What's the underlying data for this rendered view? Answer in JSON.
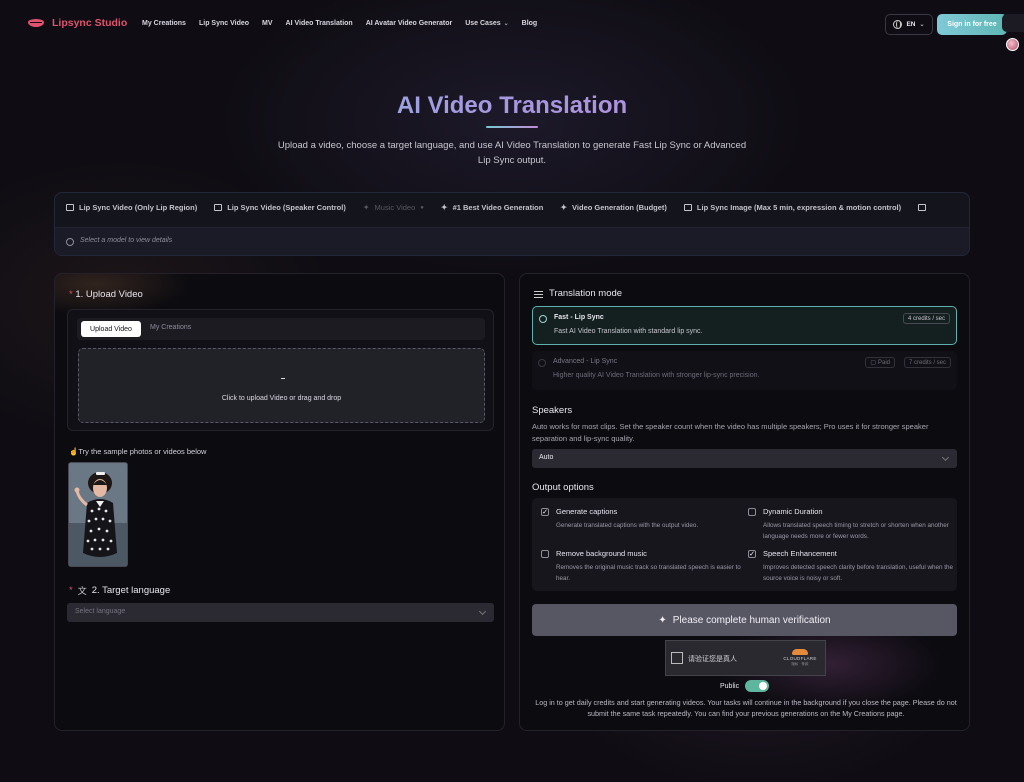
{
  "nav": {
    "brand": "Lipsync Studio",
    "links": [
      "My Creations",
      "Lip Sync Video",
      "MV",
      "AI Video Translation",
      "AI Avatar Video Generator",
      "Use Cases",
      "Blog"
    ],
    "language": "EN",
    "signin_label": "Sign in for free"
  },
  "hero": {
    "title": "AI Video Translation",
    "subtitle": "Upload a video, choose a target language, and use AI Video Translation to generate Fast Lip Sync or Advanced Lip Sync output."
  },
  "models": {
    "tabs": [
      {
        "label": "Lip Sync Video (Only Lip Region)",
        "icon": "video-icon",
        "disabled": false
      },
      {
        "label": "Lip Sync Video (Speaker Control)",
        "icon": "video-icon",
        "disabled": false
      },
      {
        "label": "Music Video",
        "icon": "music-icon",
        "disabled": true
      },
      {
        "label": "#1 Best Video Generation",
        "icon": "sparkle-icon",
        "disabled": false
      },
      {
        "label": "Video Generation (Budget)",
        "icon": "sparkle-icon",
        "disabled": false
      },
      {
        "label": "Lip Sync Image (Max 5 min, expression & motion control)",
        "icon": "image-icon",
        "disabled": false
      }
    ],
    "hint": "Select a model to view details"
  },
  "upload": {
    "section_label": "1. Upload Video",
    "tab_active": "Upload Video",
    "tab_other": "My Creations",
    "dropzone_dash": "-",
    "dropzone_text": "Click to upload Video or drag and drop",
    "sample_label": "Try the sample photos or videos below"
  },
  "target": {
    "section_label": "2. Target language",
    "placeholder": "Select language"
  },
  "translation": {
    "title": "Translation mode",
    "options": [
      {
        "name": "Fast - Lip Sync",
        "desc": "Fast AI Video Translation with standard lip sync.",
        "credits": "4 credits / sec",
        "badge": ""
      },
      {
        "name": "Advanced - Lip Sync",
        "desc": "Higher quality AI Video Translation with stronger lip-sync precision.",
        "credits": "7 credits / sec",
        "badge": "Paid"
      }
    ]
  },
  "speakers": {
    "title": "Speakers",
    "desc": "Auto works for most clips. Set the speaker count when the video has multiple speakers; Pro uses it for stronger speaker separation and lip-sync quality.",
    "value": "Auto"
  },
  "output": {
    "title": "Output options",
    "options": [
      {
        "name": "Generate captions",
        "desc": "Generate translated captions with the output video.",
        "checked": true
      },
      {
        "name": "Dynamic Duration",
        "desc": "Allows translated speech timing to stretch or shorten when another language needs more or fewer words.",
        "checked": false
      },
      {
        "name": "Remove background music",
        "desc": "Removes the original music track so translated speech is easier to hear.",
        "checked": false
      },
      {
        "name": "Speech Enhancement",
        "desc": "Improves detected speech clarity before translation, useful when the source voice is noisy or soft.",
        "checked": true
      }
    ]
  },
  "cta": {
    "label": "Please complete human verification"
  },
  "captcha": {
    "text": "请验证您是真人",
    "brand": "CLOUDFLARE",
    "links": "隐私 · 条款"
  },
  "public_label": "Public",
  "notice": "Log in to get daily credits and start generating videos. Your tasks will continue in the background if you close the page. Please do not submit the same task repeatedly. You can find your previous generations on the My Creations page.",
  "colors": {
    "accent": "#5fb6b3",
    "brand": "#e0526e",
    "background": "#0f0d13"
  }
}
